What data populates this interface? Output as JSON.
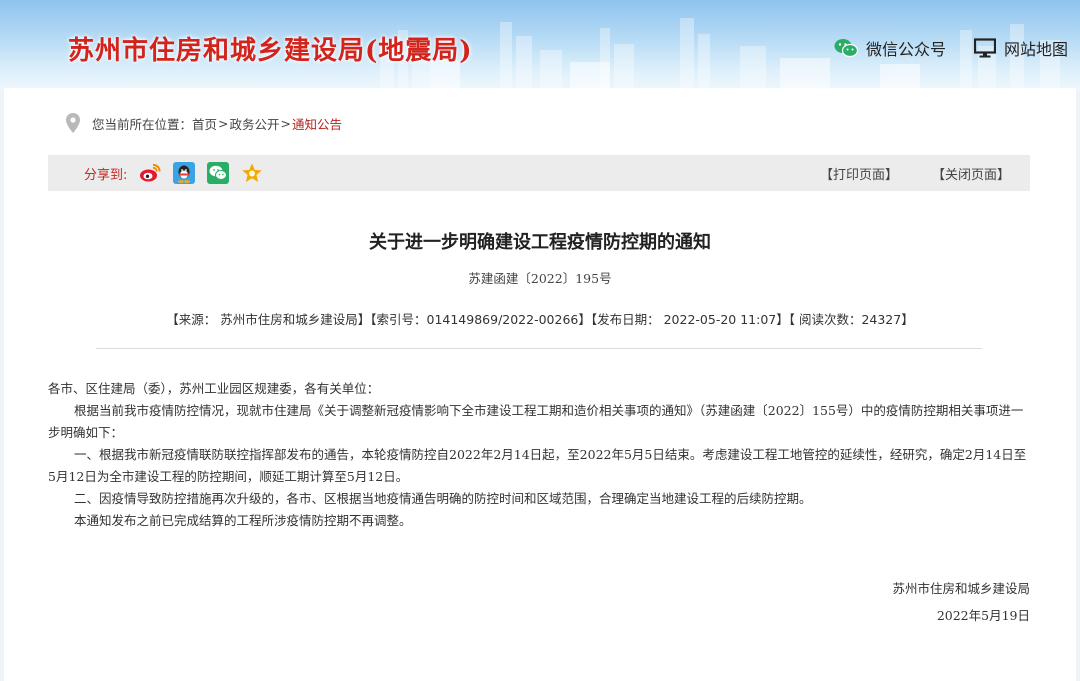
{
  "header": {
    "site_title": "苏州市住房和城乡建设局(地震局)",
    "wechat_label": "微信公众号",
    "sitemap_label": "网站地图"
  },
  "breadcrumb": {
    "prefix": "您当前所在位置：",
    "items": [
      "首页",
      "政务公开",
      "通知公告"
    ],
    "separator": ">"
  },
  "sharebar": {
    "label": "分享到:",
    "icons": [
      "weibo-icon",
      "qq-icon",
      "wechat-icon",
      "favorite-star-icon"
    ],
    "print_label": "【打印页面】",
    "close_label": "【关闭页面】"
  },
  "article": {
    "title": "关于进一步明确建设工程疫情防控期的通知",
    "doc_number": "苏建函建〔2022〕195号",
    "meta": "【来源： 苏州市住房和城乡建设局】【索引号：014149869/2022-00266】【发布日期： 2022-05-20 11:07】【 阅读次数：24327】",
    "paragraphs": [
      "各市、区住建局（委），苏州工业园区规建委，各有关单位：",
      "根据当前我市疫情防控情况，现就市住建局《关于调整新冠疫情影响下全市建设工程工期和造价相关事项的通知》（苏建函建〔2022〕155号）中的疫情防控期相关事项进一步明确如下：",
      "一、根据我市新冠疫情联防联控指挥部发布的通告，本轮疫情防控自2022年2月14日起，至2022年5月5日结束。考虑建设工程工地管控的延续性，经研究，确定2月14日至5月12日为全市建设工程的防控期间，顺延工期计算至5月12日。",
      "二、因疫情导致防控措施再次升级的，各市、区根据当地疫情通告明确的防控时间和区域范围，合理确定当地建设工程的后续防控期。",
      "本通知发布之前已完成结算的工程所涉疫情防控期不再调整。"
    ],
    "signature_org": "苏州市住房和城乡建设局",
    "signature_date": "2022年5月19日"
  },
  "colors": {
    "title_red": "#d2231c",
    "breadcrumb_current": "#b3251e",
    "share_label": "#c8261d",
    "sharebar_bg": "#ececec"
  }
}
